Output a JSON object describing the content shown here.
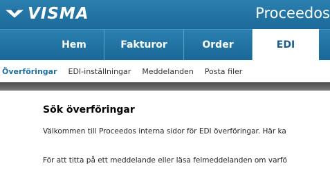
{
  "brand": {
    "logo_text": "VISMA",
    "app_title": "Proceedos"
  },
  "nav": {
    "tabs": [
      {
        "label": "Hem"
      },
      {
        "label": "Fakturor"
      },
      {
        "label": "Order"
      },
      {
        "label": "EDI",
        "active": true
      }
    ]
  },
  "subnav": {
    "items": [
      {
        "label": "Överföringar",
        "active": true
      },
      {
        "label": "EDI-inställningar"
      },
      {
        "label": "Meddelanden"
      },
      {
        "label": "Posta filer"
      }
    ]
  },
  "main": {
    "heading": "Sök överföringar",
    "paragraph1": "Välkommen till Proceedos interna sidor för EDI överföringar. Här ka",
    "paragraph2": "För att titta på ett meddelande eller läsa felmeddelanden om varfö"
  },
  "colors": {
    "header_blue": "#1f6e9d",
    "active_link": "#1a6fa3",
    "divider_gray": "#5a5a5a"
  }
}
